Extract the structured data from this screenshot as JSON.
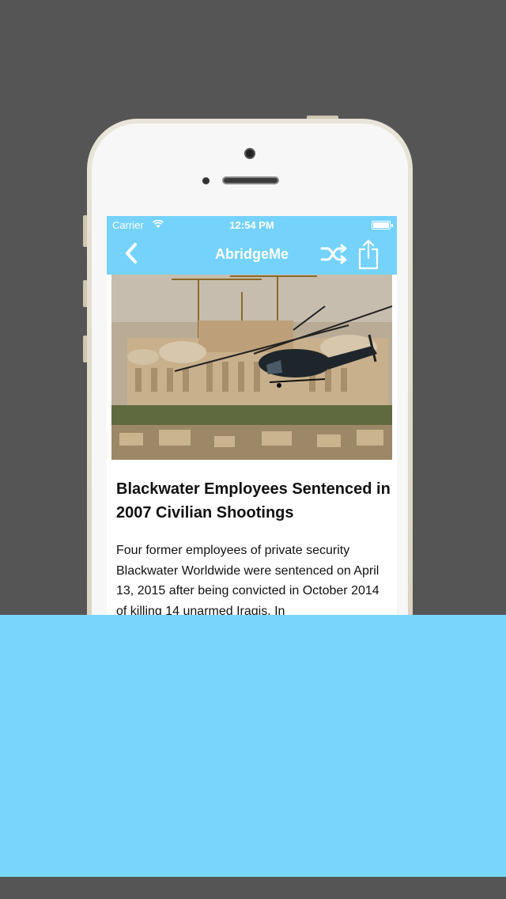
{
  "status_bar": {
    "carrier": "Carrier",
    "time": "12:54 PM"
  },
  "nav": {
    "title": "AbridgeMe",
    "back_icon": "chevron-left-icon",
    "shuffle_icon": "shuffle-icon",
    "share_icon": "share-icon"
  },
  "article": {
    "image_subject": "helicopter-over-city",
    "title": "Blackwater Employees Sentenced in 2007 Civilian Shootings",
    "body": "Four former employees of private security Blackwater Worldwide were sentenced on April 13, 2015 after being convicted in October 2014 of killing 14 unarmed Iraqis. In"
  },
  "colors": {
    "accent": "#75d2fb",
    "background": "#555555",
    "overlay": "#7ad5fd",
    "phone_frame": "#e2dccd"
  }
}
